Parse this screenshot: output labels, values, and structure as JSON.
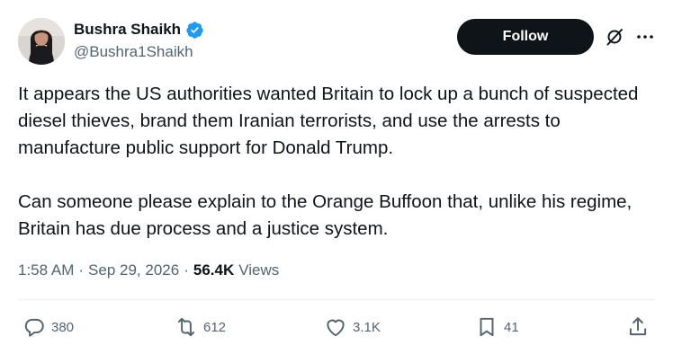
{
  "author": {
    "display_name": "Bushra Shaikh",
    "handle": "@Bushra1Shaikh",
    "verified": true,
    "verified_color": "#1d9bf0"
  },
  "header_actions": {
    "follow_label": "Follow",
    "follow_bg": "#0f1419",
    "grok_icon": "grok-icon",
    "more_icon": "more-horizontal-icon"
  },
  "tweet": {
    "paragraphs": [
      "It appears the US authorities wanted Britain to lock up a bunch of suspected diesel thieves, brand them Iranian terrorists, and use the arrests to manufacture public support for Donald Trump.",
      "Can someone please explain to the Orange Buffoon that, unlike his regime, Britain has due process  and a justice system."
    ]
  },
  "meta": {
    "time": "1:58 AM",
    "separator": "·",
    "date": "Sep 29, 2026",
    "views_count": "56.4K",
    "views_label": "Views"
  },
  "actions": {
    "reply": {
      "icon": "reply-icon",
      "count": "380"
    },
    "repost": {
      "icon": "repost-icon",
      "count": "612"
    },
    "like": {
      "icon": "heart-icon",
      "count": "3.1K"
    },
    "bookmark": {
      "icon": "bookmark-icon",
      "count": "41"
    },
    "share": {
      "icon": "share-icon"
    }
  },
  "colors": {
    "text_primary": "#0f1419",
    "text_secondary": "#536471",
    "divider": "#eff3f4"
  }
}
